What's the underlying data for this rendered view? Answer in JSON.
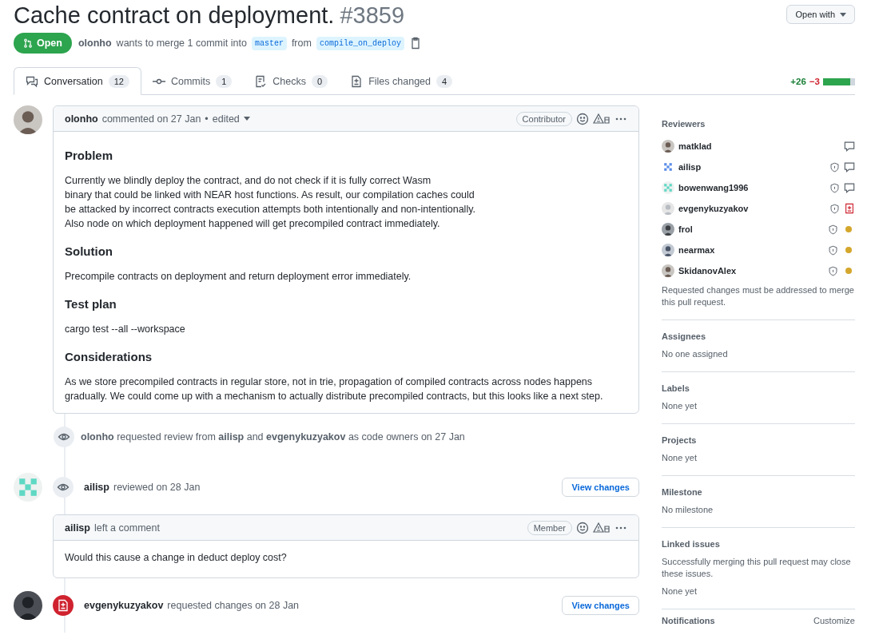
{
  "header": {
    "title": "Cache contract on deployment.",
    "number": "#3859",
    "open_with": "Open with"
  },
  "status": {
    "state": "Open",
    "author": "olonho",
    "text": "wants to merge 1 commit into",
    "base": "master",
    "from": "from",
    "head": "compile_on_deploy"
  },
  "tabs": [
    {
      "kind": "conversation",
      "label": "Conversation",
      "count": "12",
      "selected": true
    },
    {
      "kind": "commits",
      "label": "Commits",
      "count": "1",
      "selected": false
    },
    {
      "kind": "checks",
      "label": "Checks",
      "count": "0",
      "selected": false
    },
    {
      "kind": "files",
      "label": "Files changed",
      "count": "4",
      "selected": false
    }
  ],
  "diffstat": {
    "additions": "+26",
    "deletions": "−3",
    "level": 0.85
  },
  "timeline": [
    {
      "kind": "comment",
      "avatar": {
        "kind": "photo"
      },
      "author": "olonho",
      "action": "commented on 27 Jan",
      "separator": "•",
      "edited": "edited",
      "role": "Contributor",
      "sections": [
        {
          "heading": "Problem",
          "lines": [
            "Currently we blindly deploy the contract, and do not check if it is fully correct Wasm",
            "binary that could be linked with NEAR host functions. As result, our compilation caches could",
            "be attacked by incorrect contracts execution attempts both intentionally and non-intentionally.",
            "Also node on which deployment happened will get precompiled contract immediately."
          ]
        },
        {
          "heading": "Solution",
          "lines": [
            "Precompile contracts on deployment and return deployment error immediately."
          ]
        },
        {
          "heading": "Test plan",
          "lines": [
            "cargo test --all --workspace"
          ]
        },
        {
          "heading": "Considerations",
          "lines": [
            "As we store precompiled contracts in regular store, not in trie, propagation of compiled contracts across nodes happens gradually. We could come up with a mechanism to actually distribute precompiled contracts, but this looks like a next step."
          ]
        }
      ]
    },
    {
      "kind": "event",
      "text": "**olonho** requested review from **ailisp** and **evgenykuzyakov** as code owners on 27 Jan"
    },
    {
      "kind": "review",
      "avatar": {
        "kind": "identicon"
      },
      "author": "ailisp",
      "text": "reviewed on 28 Jan",
      "button": "View changes",
      "comment": {
        "author": "ailisp",
        "action": "left a comment",
        "role": "Member",
        "body": "Would this cause a change in deduct deploy cost?"
      }
    },
    {
      "kind": "changes",
      "avatar": {
        "kind": "photo"
      },
      "author": "evgenykuzyakov",
      "text": "requested changes on 28 Jan",
      "button": "View changes"
    }
  ],
  "sidebar": {
    "reviewers_title": "Reviewers",
    "reviewers": [
      {
        "kind": "commented",
        "avatar": {
          "kind": "photo"
        },
        "name": "matklad",
        "code_owner": false
      },
      {
        "kind": "commented",
        "avatar": {
          "kind": "identicon"
        },
        "name": "ailisp",
        "code_owner": true
      },
      {
        "kind": "commented",
        "avatar": {
          "kind": "identicon"
        },
        "name": "bowenwang1996",
        "code_owner": true
      },
      {
        "kind": "changes",
        "avatar": {
          "kind": "photo"
        },
        "name": "evgenykuzyakov",
        "code_owner": true
      },
      {
        "kind": "pending",
        "avatar": {
          "kind": "photo"
        },
        "name": "frol",
        "code_owner": true
      },
      {
        "kind": "pending",
        "avatar": {
          "kind": "photo"
        },
        "name": "nearmax",
        "code_owner": true
      },
      {
        "kind": "pending",
        "avatar": {
          "kind": "photo"
        },
        "name": "SkidanovAlex",
        "code_owner": true
      }
    ],
    "reviewers_note": "Requested changes must be addressed to merge this pull request.",
    "sections": [
      {
        "title": "Assignees",
        "lines": [
          "No one assigned"
        ]
      },
      {
        "title": "Labels",
        "lines": [
          "None yet"
        ]
      },
      {
        "title": "Projects",
        "lines": [
          "None yet"
        ]
      },
      {
        "title": "Milestone",
        "lines": [
          "No milestone"
        ]
      },
      {
        "title": "Linked issues",
        "lines": [
          "Successfully merging this pull request may close these issues.",
          "None yet"
        ]
      }
    ],
    "notifications": {
      "title": "Notifications",
      "action": "Customize"
    }
  }
}
